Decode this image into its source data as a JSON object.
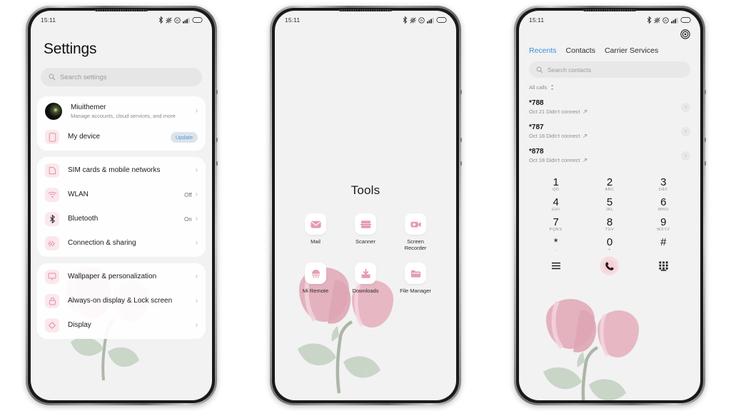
{
  "status_bar": {
    "time": "15:11",
    "icons": [
      "bluetooth-icon",
      "mute-vibrate-icon",
      "roaming-r-icon",
      "signal-bars-icon",
      "battery-icon"
    ]
  },
  "colors": {
    "screen_bg": "#f2f2f2",
    "card_bg": "#ffffff",
    "accent_blue": "#3e8ee0",
    "icon_pink": "#e9a3b4",
    "icon_tile_pink": "#fbe8ec",
    "petal_pink": "#e7b0bf",
    "leaf_green": "#c2d2c2",
    "frame_dark": "#1a1a1a"
  },
  "phone1_settings": {
    "title": "Settings",
    "search": {
      "placeholder": "Search settings",
      "icon": "search-icon"
    },
    "account": {
      "name": "Miuithemer",
      "subtitle": "Manage accounts, cloud services, and more",
      "avatar": "user-avatar"
    },
    "device": {
      "label": "My device",
      "badge": "Update",
      "icon": "phone-device-icon"
    },
    "items": [
      {
        "label": "SIM cards & mobile networks",
        "value": "",
        "icon": "sim-card-icon"
      },
      {
        "label": "WLAN",
        "value": "Off",
        "icon": "wifi-icon"
      },
      {
        "label": "Bluetooth",
        "value": "On",
        "icon": "bluetooth-icon"
      },
      {
        "label": "Connection & sharing",
        "value": "",
        "icon": "connection-sharing-icon"
      }
    ],
    "items2": [
      {
        "label": "Wallpaper & personalization",
        "value": "",
        "icon": "wallpaper-icon"
      },
      {
        "label": "Always-on display & Lock screen",
        "value": "",
        "icon": "lock-icon"
      },
      {
        "label": "Display",
        "value": "",
        "icon": "display-brightness-icon"
      }
    ]
  },
  "phone2_folder": {
    "title": "Tools",
    "apps": [
      {
        "label": "Mail",
        "icon": "mail-icon"
      },
      {
        "label": "Scanner",
        "icon": "scanner-icon"
      },
      {
        "label": "Screen Recorder",
        "icon": "screen-recorder-icon"
      },
      {
        "label": "Mi Remote",
        "icon": "mi-remote-icon"
      },
      {
        "label": "Downloads",
        "icon": "download-icon"
      },
      {
        "label": "File Manager",
        "icon": "folder-icon"
      }
    ]
  },
  "phone3_dialer": {
    "settings_icon": "gear-icon",
    "tabs": [
      {
        "label": "Recents",
        "active": true
      },
      {
        "label": "Contacts",
        "active": false
      },
      {
        "label": "Carrier Services",
        "active": false
      }
    ],
    "search": {
      "placeholder": "Search contacts",
      "icon": "search-icon"
    },
    "filter": {
      "label": "All calls",
      "icon": "sort-updown-icon"
    },
    "calls": [
      {
        "number": "*788",
        "detail": "Oct 21 Didn't connect",
        "status_icon": "outgoing-call-arrow-icon"
      },
      {
        "number": "*787",
        "detail": "Oct 18 Didn't connect",
        "status_icon": "outgoing-call-arrow-icon"
      },
      {
        "number": "*878",
        "detail": "Oct 18 Didn't connect",
        "status_icon": "outgoing-call-arrow-icon"
      }
    ],
    "keys": [
      {
        "num": "1",
        "letters": "QD"
      },
      {
        "num": "2",
        "letters": "ABC"
      },
      {
        "num": "3",
        "letters": "DEF"
      },
      {
        "num": "4",
        "letters": "GHI"
      },
      {
        "num": "5",
        "letters": "JKL"
      },
      {
        "num": "6",
        "letters": "MNO"
      },
      {
        "num": "7",
        "letters": "PQRS"
      },
      {
        "num": "8",
        "letters": "TUV"
      },
      {
        "num": "9",
        "letters": "WXYZ"
      },
      {
        "num": "*",
        "letters": ","
      },
      {
        "num": "0",
        "letters": "+"
      },
      {
        "num": "#",
        "letters": ""
      }
    ],
    "actions": [
      {
        "icon": "menu-lines-icon"
      },
      {
        "icon": "call-phone-icon"
      },
      {
        "icon": "keypad-grid-icon"
      }
    ]
  }
}
